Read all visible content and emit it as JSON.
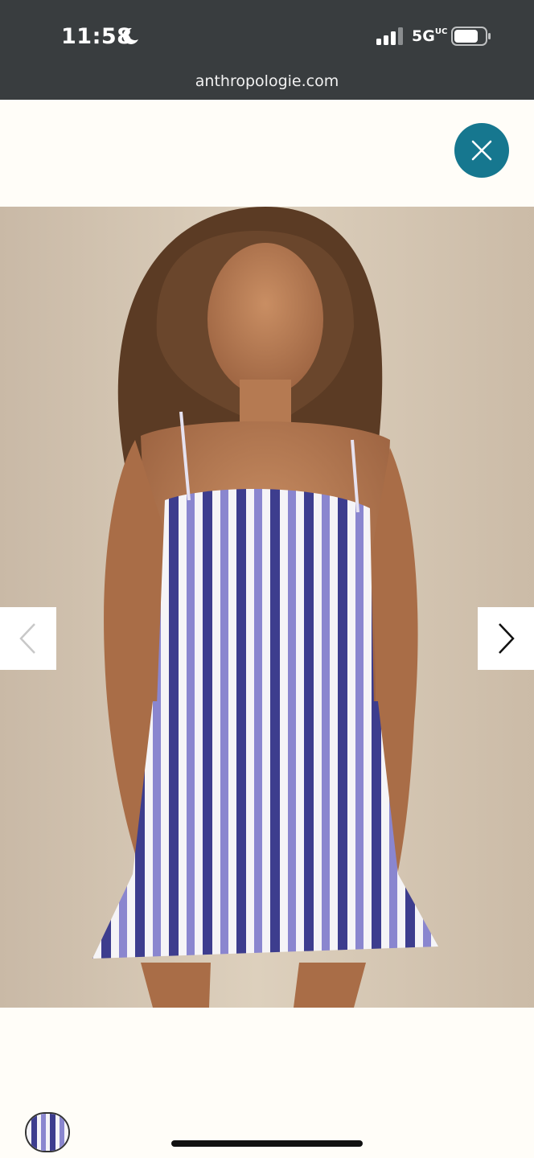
{
  "status_bar": {
    "time": "11:58",
    "network": "5G",
    "network_suffix": "UC",
    "icons": [
      "moon-icon",
      "signal-icon",
      "battery-icon"
    ]
  },
  "browser": {
    "url": "anthropologie.com"
  },
  "viewer": {
    "close_icon": "close-icon",
    "prev_icon": "chevron-left-icon",
    "next_icon": "chevron-right-icon",
    "accent_color": "#16778f",
    "product_image": "model-in-striped-smocked-mini-dress",
    "thumbnail_count": 1
  }
}
